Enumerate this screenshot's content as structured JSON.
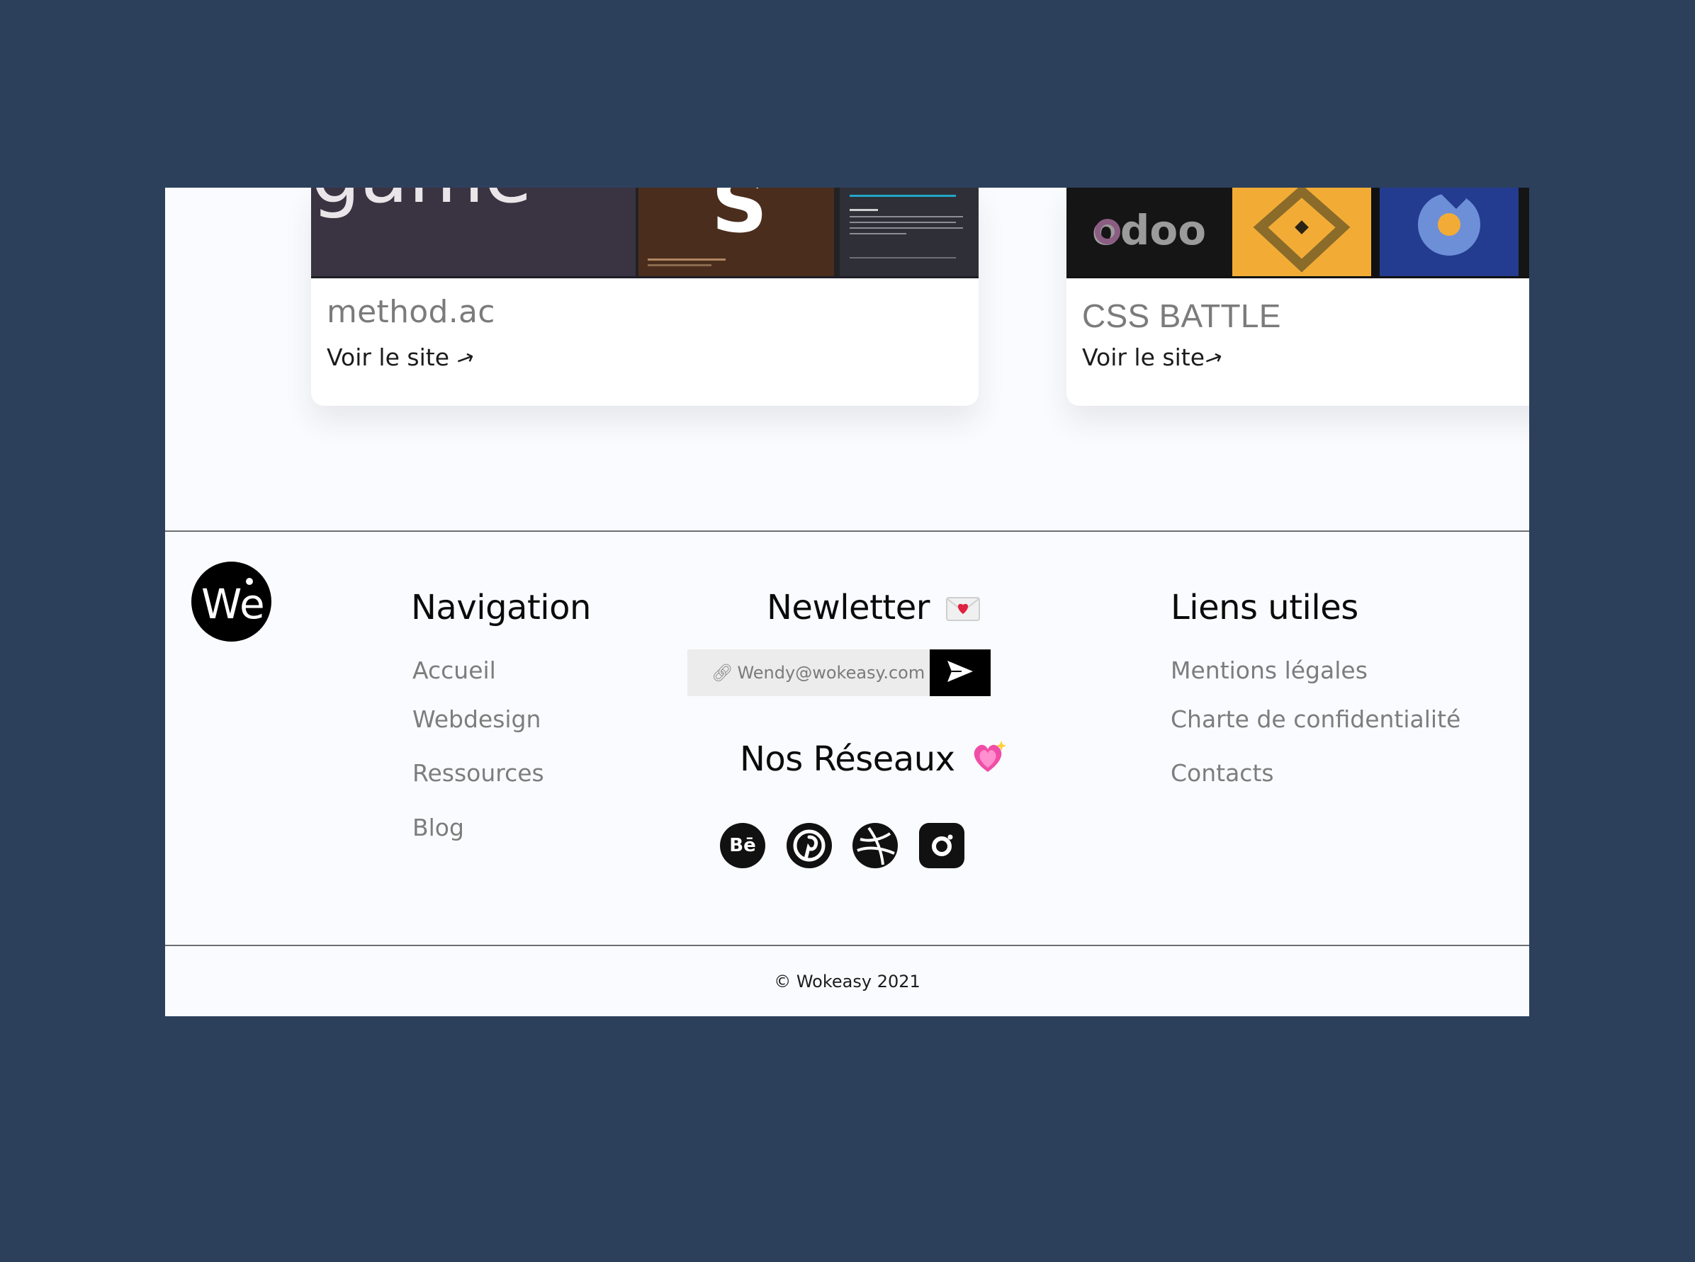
{
  "colors": {
    "backdrop": "#2c405c",
    "page_bg": "#fafbfe",
    "text_dark": "#0b0b0b",
    "text_muted": "#7d7d7d",
    "accent_yellow": "#f2ac36",
    "accent_blue": "#233c8f"
  },
  "cards": [
    {
      "title": "method.ac",
      "link_label": "Voir le site",
      "link_icon": "arrow-up-right-icon",
      "thumb_text": "game"
    },
    {
      "title": "CSS BATTLE",
      "link_label": "Voir le site",
      "link_icon": "arrow-up-right-icon",
      "thumb_text": "odoo"
    }
  ],
  "footer": {
    "logo_text": "We",
    "navigation": {
      "title": "Navigation",
      "items": [
        "Accueil",
        "Webdesign",
        "Ressources",
        "Blog"
      ]
    },
    "newsletter": {
      "title": "Newletter",
      "title_icon": "love-letter-icon",
      "placeholder": "Wendy@wokeasy.com",
      "input_icon": "link-icon",
      "submit_icon": "send-arrow-icon"
    },
    "socials": {
      "title": "Nos Réseaux",
      "title_icon": "sparkling-heart-icon",
      "items": [
        {
          "name": "behance-icon",
          "glyph": "Bē"
        },
        {
          "name": "pinterest-icon"
        },
        {
          "name": "dribbble-icon"
        },
        {
          "name": "instagram-icon"
        }
      ]
    },
    "useful_links": {
      "title": "Liens utiles",
      "items": [
        "Mentions légales",
        "Charte de confidentialité",
        "Contacts"
      ]
    },
    "copyright": "© Wokeasy 2021"
  }
}
